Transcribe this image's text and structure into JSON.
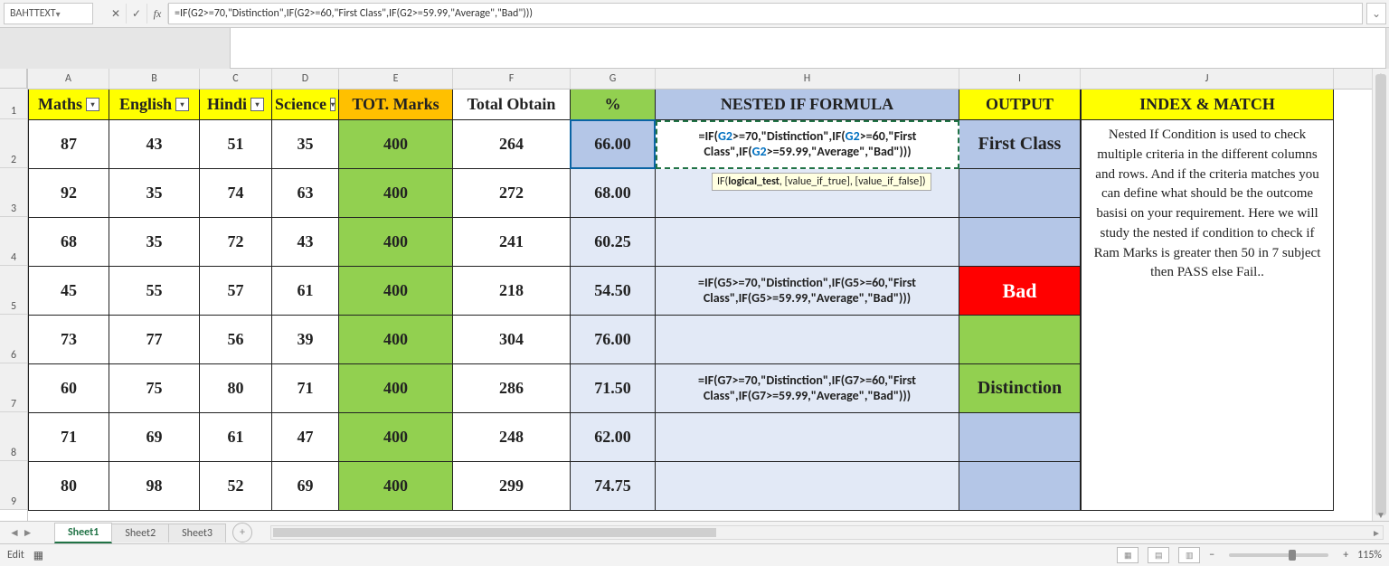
{
  "name_box": "BAHTTEXT",
  "formula": "=IF(G2>=70,\"Distinction\",IF(G2>=60,\"First Class\",IF(G2>=59.99,\"Average\",\"Bad\")))",
  "columns": [
    "A",
    "B",
    "C",
    "D",
    "E",
    "F",
    "G",
    "H",
    "I",
    "J"
  ],
  "row_labels": [
    "1",
    "2",
    "3",
    "4",
    "5",
    "6",
    "7",
    "8",
    "9"
  ],
  "headers": {
    "A": "Maths",
    "B": "English",
    "C": "Hindi",
    "D": "Science",
    "E": "TOT. Marks",
    "F": "Total Obtain",
    "G": "%",
    "H": "NESTED IF FORMULA",
    "I": "OUTPUT",
    "J": "INDEX & MATCH"
  },
  "rows": [
    {
      "A": "87",
      "B": "43",
      "C": "51",
      "D": "35",
      "E": "400",
      "F": "264",
      "G": "66.00",
      "H": "=IF(G2>=70,\"Distinction\",IF(G2>=60,\"First Class\",IF(G2>=59.99,\"Average\",\"Bad\")))",
      "I": "First Class"
    },
    {
      "A": "92",
      "B": "35",
      "C": "74",
      "D": "63",
      "E": "400",
      "F": "272",
      "G": "68.00",
      "H": "",
      "I": ""
    },
    {
      "A": "68",
      "B": "35",
      "C": "72",
      "D": "43",
      "E": "400",
      "F": "241",
      "G": "60.25",
      "H": "",
      "I": ""
    },
    {
      "A": "45",
      "B": "55",
      "C": "57",
      "D": "61",
      "E": "400",
      "F": "218",
      "G": "54.50",
      "H": "=IF(G5>=70,\"Distinction\",IF(G5>=60,\"First Class\",IF(G5>=59.99,\"Average\",\"Bad\")))",
      "I": "Bad"
    },
    {
      "A": "73",
      "B": "77",
      "C": "56",
      "D": "39",
      "E": "400",
      "F": "304",
      "G": "76.00",
      "H": "",
      "I": ""
    },
    {
      "A": "60",
      "B": "75",
      "C": "80",
      "D": "71",
      "E": "400",
      "F": "286",
      "G": "71.50",
      "H": "=IF(G7>=70,\"Distinction\",IF(G7>=60,\"First Class\",IF(G7>=59.99,\"Average\",\"Bad\")))",
      "I": "Distinction"
    },
    {
      "A": "71",
      "B": "69",
      "C": "61",
      "D": "47",
      "E": "400",
      "F": "248",
      "G": "62.00",
      "H": "",
      "I": ""
    },
    {
      "A": "80",
      "B": "98",
      "C": "52",
      "D": "69",
      "E": "400",
      "F": "299",
      "G": "74.75",
      "H": "",
      "I": ""
    }
  ],
  "h2_parts": {
    "pre": "=IF(",
    "g1": "G2",
    "mid1": ">=70,\"Distinction\",IF(",
    "g2": "G2",
    "mid2": ">=60,\"First Class\",IF(",
    "g3": "G2",
    "post": ">=59.99,\"Average\",\"Bad\")))"
  },
  "tooltip": "IF(logical_test, [value_if_true], [value_if_false])",
  "tooltip_bold": "logical_test",
  "description": "Nested If Condition is used to check multiple criteria in the different columns and rows. And if the criteria matches you can define what should be the outcome basisi on your requirement. Here we will study the nested if condition to check if Ram Marks is greater then 50 in 7 subject then PASS else Fail..",
  "sheets": [
    "Sheet1",
    "Sheet2",
    "Sheet3"
  ],
  "status_mode": "Edit",
  "zoom": "115%"
}
